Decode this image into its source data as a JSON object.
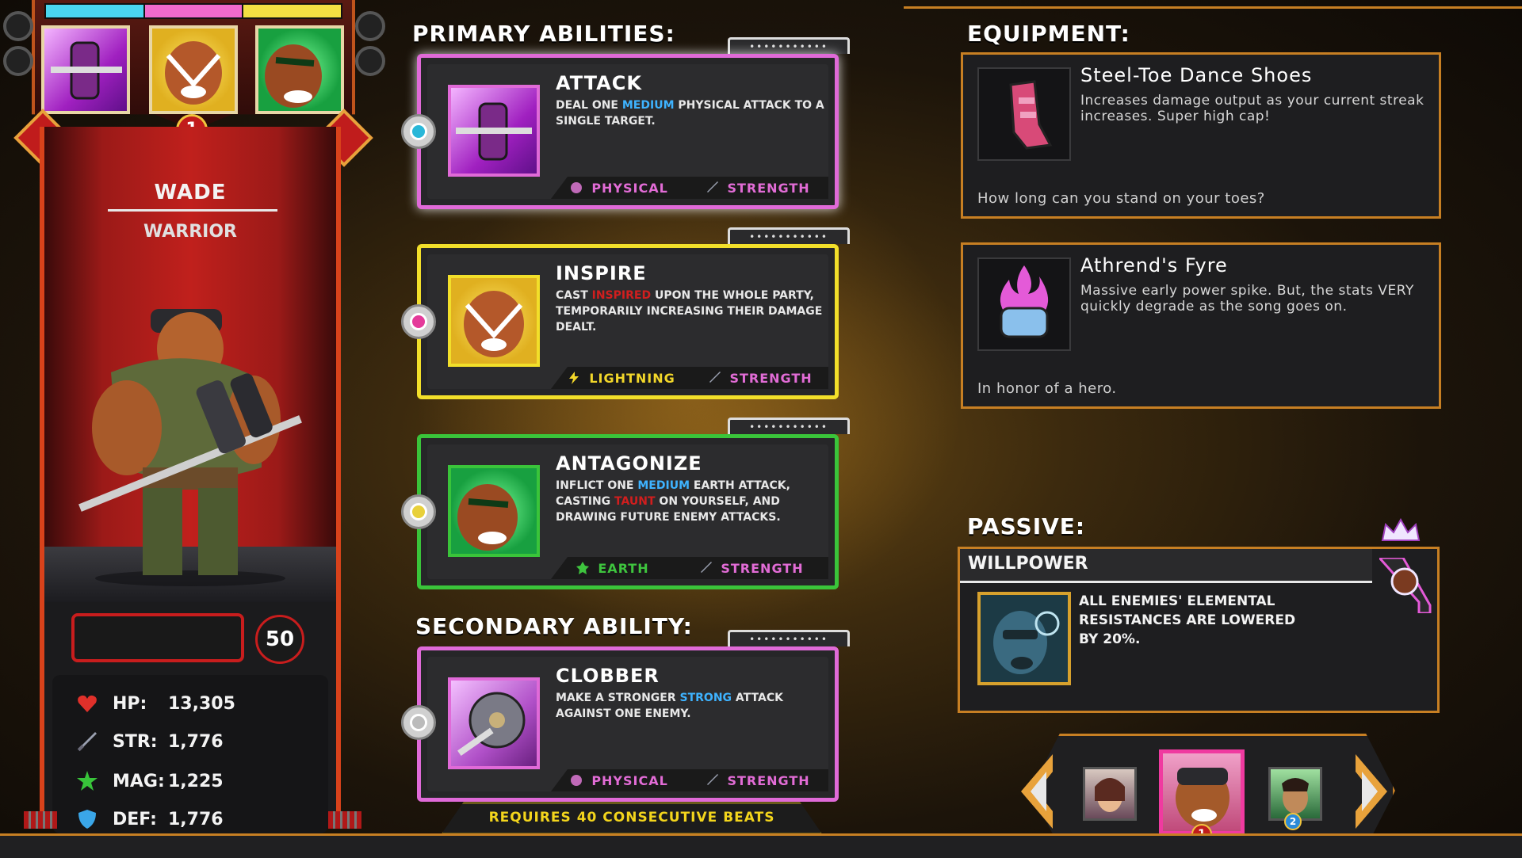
{
  "character": {
    "name": "WADE",
    "class": "WARRIOR",
    "level": "50",
    "rank_badge": "1",
    "stats": [
      {
        "label": "HP:",
        "value": "13,305",
        "icon": "heart-icon",
        "color": "#e0302a"
      },
      {
        "label": "STR:",
        "value": "1,776",
        "icon": "sword-icon",
        "color": "#9aa0b0"
      },
      {
        "label": "MAG:",
        "value": "1,225",
        "icon": "star-icon",
        "color": "#38c43a"
      },
      {
        "label": "DEF:",
        "value": "1,776",
        "icon": "shield-icon",
        "color": "#3aa6e8"
      }
    ],
    "team_bar_colors": [
      "#4ad6f0",
      "#f06acb",
      "#f2df43"
    ]
  },
  "primary": {
    "title": "PRIMARY ABILITIES:",
    "abilities": [
      {
        "name": "ATTACK",
        "desc_parts": [
          "DEAL ONE ",
          "MEDIUM",
          " PHYSICAL ATTACK TO A SINGLE TARGET."
        ],
        "highlight_color": "#3eb3ff",
        "tag1": "PHYSICAL",
        "tag1_color": "#e26cd6",
        "tag1_icon": "fist-icon",
        "tag2": "STRENGTH",
        "tag2_color": "#e26cd6",
        "border_color": "#e06ad8",
        "selector_color": "#29b7d8",
        "tab_label": "•••••••••••"
      },
      {
        "name": "INSPIRE",
        "desc_parts": [
          "CAST ",
          "INSPIRED",
          " UPON THE WHOLE PARTY, TEMPORARILY INCREASING THEIR DAMAGE DEALT."
        ],
        "highlight_color": "#d11e1e",
        "tag1": "LIGHTNING",
        "tag1_color": "#f2d72a",
        "tag1_icon": "lightning-icon",
        "tag2": "STRENGTH",
        "tag2_color": "#e26cd6",
        "border_color": "#f2df2a",
        "selector_color": "#e43a9a",
        "tab_label": "•••••••••••"
      },
      {
        "name": "ANTAGONIZE",
        "desc_parts": [
          "INFLICT ONE ",
          "MEDIUM",
          " EARTH ATTACK, CASTING ",
          "TAUNT",
          " ON YOURSELF, AND DRAWING FUTURE ENEMY ATTACKS."
        ],
        "highlight_color": "#3eb3ff",
        "highlight_color2": "#d11e1e",
        "tag1": "EARTH",
        "tag1_color": "#3ec43e",
        "tag1_icon": "earth-icon",
        "tag2": "STRENGTH",
        "tag2_color": "#e26cd6",
        "border_color": "#3ac43a",
        "selector_color": "#e8d03a",
        "tab_label": "•••••••••••"
      }
    ]
  },
  "secondary": {
    "title": "SECONDARY ABILITY:",
    "ability": {
      "name": "CLOBBER",
      "desc_parts": [
        "MAKE A STRONGER ",
        "STRONG",
        " ATTACK AGAINST ONE ENEMY."
      ],
      "highlight_color": "#3eb3ff",
      "tag1": "PHYSICAL",
      "tag1_color": "#e26cd6",
      "tag1_icon": "fist-icon",
      "tag2": "STRENGTH",
      "tag2_color": "#e26cd6",
      "border_color": "#e06ad8",
      "selector_color": "#bbbbbb",
      "tab_label": "•••••••••••"
    },
    "requirement": "REQUIRES 40 CONSECUTIVE BEATS"
  },
  "equipment": {
    "title": "EQUIPMENT:",
    "items": [
      {
        "name": "Steel-Toe Dance Shoes",
        "desc": "Increases damage output as your current streak increases. Super high cap!",
        "flavor": "How long can you stand on your toes?",
        "icon": "dance-shoes-icon"
      },
      {
        "name": "Athrend's Fyre",
        "desc": "Massive early power spike. But, the stats VERY quickly degrade as the song goes on.",
        "flavor": "In honor of a hero.",
        "icon": "fyre-gauntlet-icon"
      }
    ]
  },
  "passive": {
    "title": "PASSIVE:",
    "name": "WILLPOWER",
    "desc": "ALL ENEMIES' ELEMENTAL RESISTANCES ARE LOWERED BY 20%.",
    "icon": "willpower-icon"
  },
  "party": {
    "members": [
      "party-member-left",
      "party-member-active",
      "party-member-right"
    ],
    "active_badge": "1",
    "right_badge": "2"
  }
}
